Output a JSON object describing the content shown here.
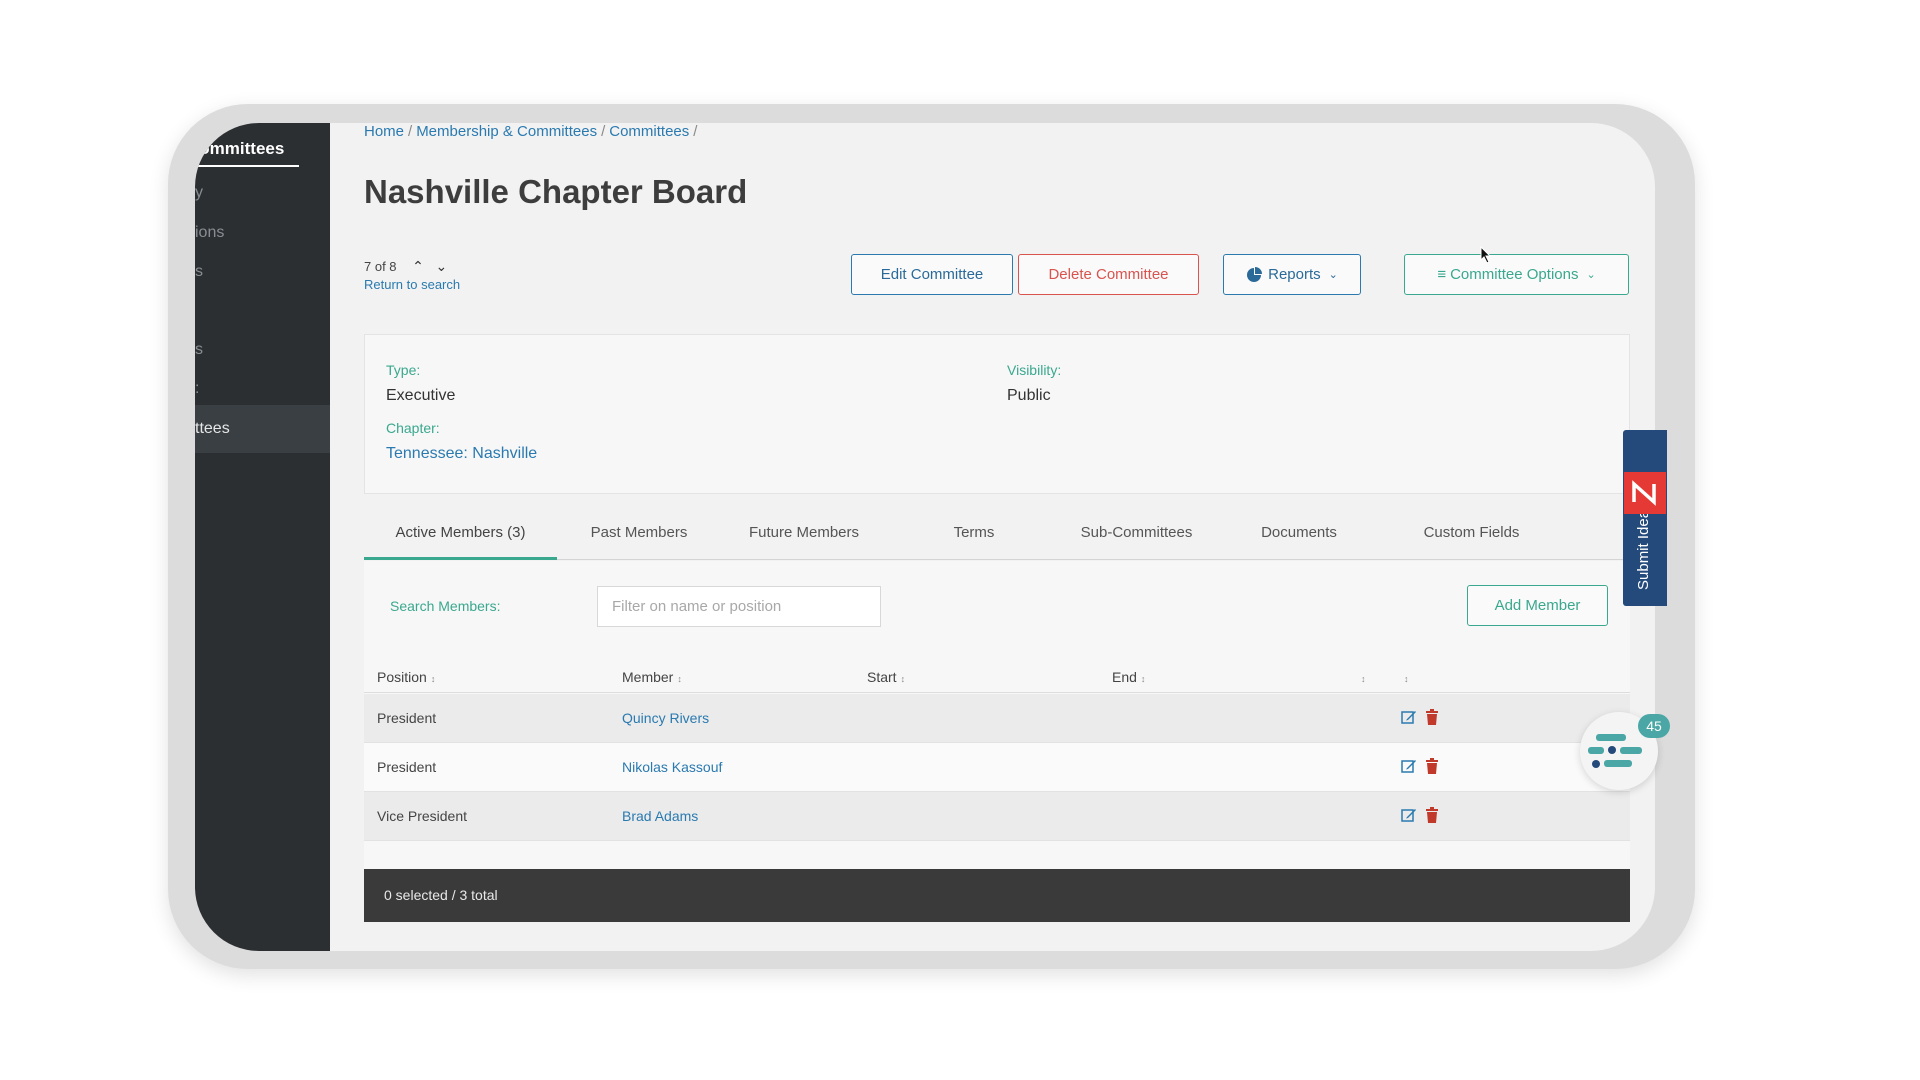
{
  "sidebar": {
    "title": "Committees",
    "items": [
      "y",
      "ions",
      "s",
      "",
      "s",
      ":",
      "ttees"
    ],
    "active_item": "ttees"
  },
  "breadcrumb": [
    "Home",
    "Membership & Committees",
    "Committees"
  ],
  "page_title": "Nashville Chapter Board",
  "pager": {
    "position": "7 of 8",
    "return_label": "Return to search"
  },
  "actions": {
    "edit": "Edit Committee",
    "delete": "Delete Committee",
    "reports": "Reports",
    "options": "Committee Options"
  },
  "details": {
    "type_label": "Type:",
    "type_value": "Executive",
    "visibility_label": "Visibility:",
    "visibility_value": "Public",
    "chapter_label": "Chapter:",
    "chapter_value": "Tennessee: Nashville"
  },
  "tabs": [
    "Active Members (3)",
    "Past Members",
    "Future Members",
    "Terms",
    "Sub-Committees",
    "Documents",
    "Custom Fields"
  ],
  "members": {
    "search_label": "Search Members:",
    "search_placeholder": "Filter on name or position",
    "add_label": "Add Member",
    "columns": [
      "Position",
      "Member",
      "Start",
      "End"
    ],
    "rows": [
      {
        "position": "President",
        "member": "Quincy Rivers",
        "start": "",
        "end": ""
      },
      {
        "position": "President",
        "member": "Nikolas Kassouf",
        "start": "",
        "end": ""
      },
      {
        "position": "Vice President",
        "member": "Brad Adams",
        "start": "",
        "end": ""
      }
    ],
    "footer": "0 selected / 3 total"
  },
  "feedback": {
    "label": "Submit Idea",
    "color": "#234a7a",
    "logo_color": "#e53935"
  },
  "chat": {
    "badge": "45"
  },
  "colors": {
    "accent": "#3aa88e",
    "link": "#2a7ab0",
    "danger": "#d9534f",
    "sidebar": "#2b2f32"
  }
}
